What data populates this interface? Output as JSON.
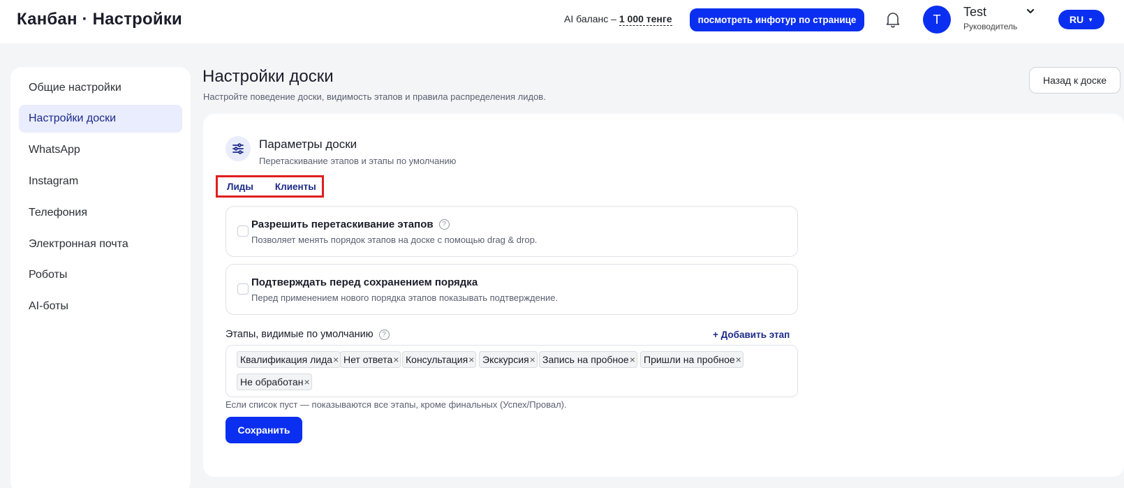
{
  "header": {
    "title": "Канбан · Настройки",
    "ai_balance_label": "AI баланс –",
    "ai_balance_value": "1 000 тенге",
    "infotour_button": "посмотреть инфотур по странице",
    "user_initial": "T",
    "user_name": "Test",
    "user_role": "Руководитель",
    "language": "RU",
    "icons": [
      "bell-icon",
      "chevron-down-icon",
      "caret-down-icon"
    ]
  },
  "sidebar": {
    "items": [
      {
        "label": "Общие настройки",
        "active": false
      },
      {
        "label": "Настройки доски",
        "active": true
      },
      {
        "label": "WhatsApp",
        "active": false
      },
      {
        "label": "Instagram",
        "active": false
      },
      {
        "label": "Телефония",
        "active": false
      },
      {
        "label": "Электронная почта",
        "active": false
      },
      {
        "label": "Роботы",
        "active": false
      },
      {
        "label": "AI-боты",
        "active": false
      }
    ]
  },
  "page": {
    "title": "Настройки доски",
    "subtitle": "Настройте поведение доски, видимость этапов и правила распределения лидов.",
    "back_button": "Назад к доске"
  },
  "section": {
    "icon": "sliders-icon",
    "title": "Параметры доски",
    "subtitle": "Перетаскивание этапов и этапы по умолчанию",
    "tabs": [
      {
        "label": "Лиды"
      },
      {
        "label": "Клиенты"
      }
    ],
    "options": [
      {
        "title": "Разрешить перетаскивание этапов",
        "description": "Позволяет менять порядок этапов на доске с помощью drag & drop.",
        "checked": false,
        "has_help": true
      },
      {
        "title": "Подтверждать перед сохранением порядка",
        "description": "Перед применением нового порядка этапов показывать подтверждение.",
        "checked": false,
        "has_help": false
      }
    ],
    "stages_label": "Этапы, видимые по умолчанию",
    "add_stage": "+ Добавить этап",
    "stages": [
      "Квалификация лида",
      "Нет ответа",
      "Консультация",
      "Экскурсия",
      "Запись на пробное",
      "Пришли на пробное",
      "Не обработан"
    ],
    "stages_hint": "Если список пуст — показываются все этапы, кроме финальных (Успех/Провал).",
    "save_button": "Сохранить"
  },
  "colors": {
    "accent": "#0b2ff0",
    "active_nav_bg": "#eaedfd",
    "highlight_border": "#e01e1e",
    "page_bg": "#f4f5f7"
  }
}
